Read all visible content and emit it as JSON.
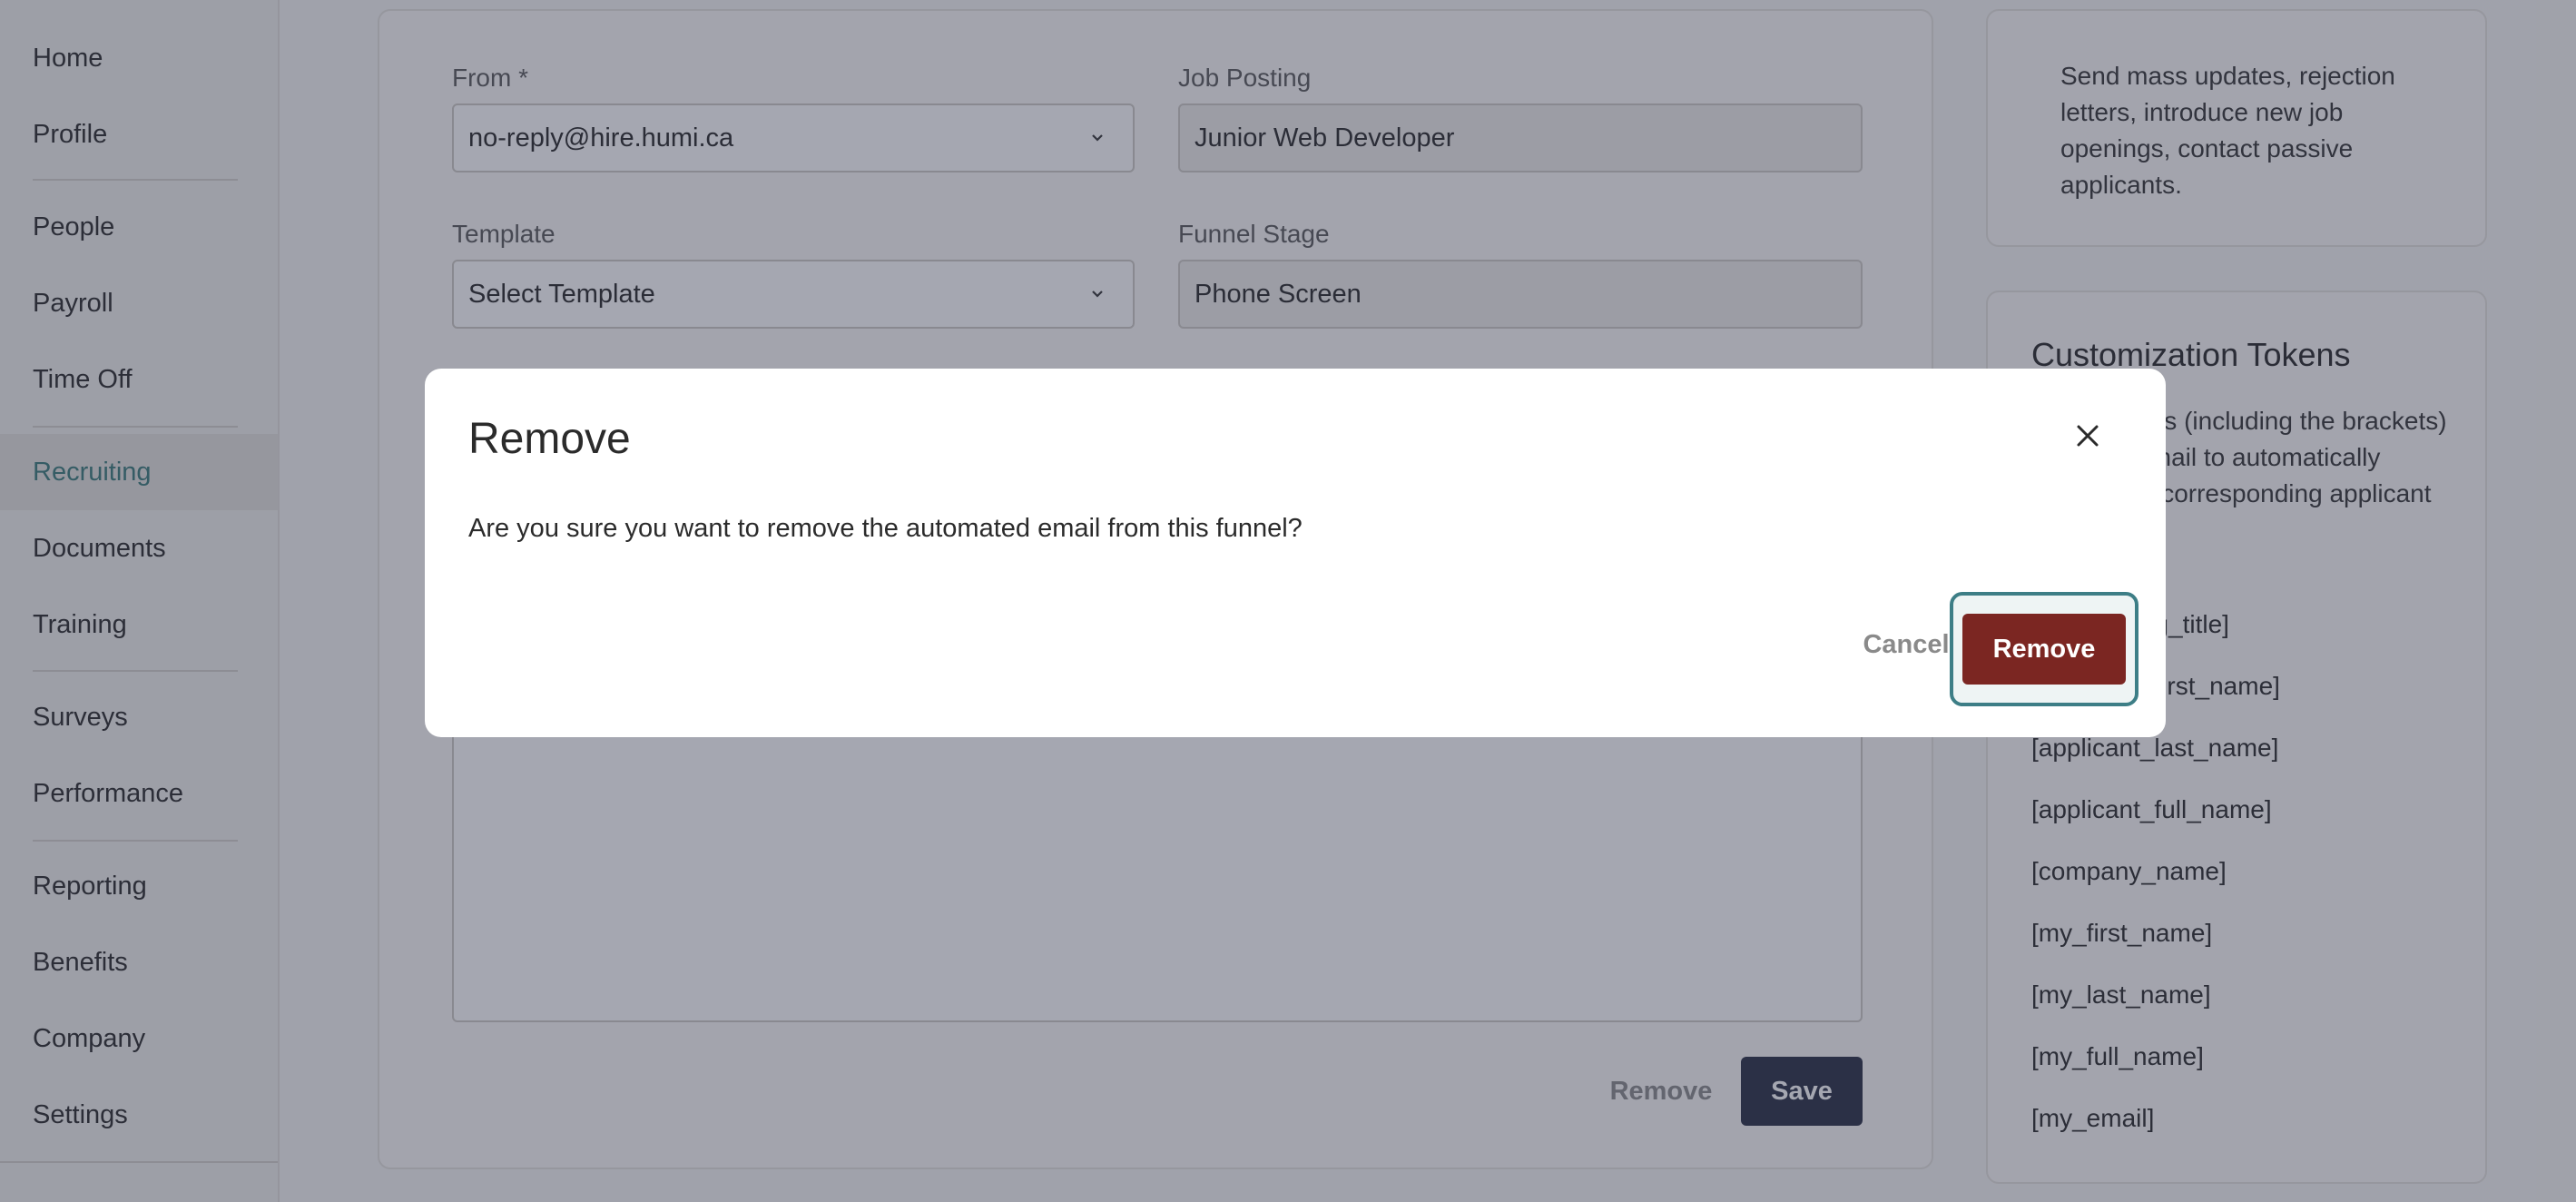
{
  "sidebar": {
    "items": [
      {
        "label": "Home"
      },
      {
        "label": "Profile"
      },
      {
        "label": "People"
      },
      {
        "label": "Payroll"
      },
      {
        "label": "Time Off"
      },
      {
        "label": "Recruiting"
      },
      {
        "label": "Documents"
      },
      {
        "label": "Training"
      },
      {
        "label": "Surveys"
      },
      {
        "label": "Performance"
      },
      {
        "label": "Reporting"
      },
      {
        "label": "Benefits"
      },
      {
        "label": "Company"
      },
      {
        "label": "Settings"
      }
    ],
    "active": "Recruiting"
  },
  "form": {
    "from": {
      "label": "From *",
      "value": "no-reply@hire.humi.ca"
    },
    "job_posting": {
      "label": "Job Posting",
      "value": "Junior Web Developer"
    },
    "template": {
      "label": "Template",
      "value": "Select Template"
    },
    "funnel_stage": {
      "label": "Funnel Stage",
      "value": "Phone Screen"
    },
    "remove_label": "Remove",
    "save_label": "Save"
  },
  "info_panel": {
    "text": "Send mass updates, rejection letters, introduce new job openings, contact passive applicants."
  },
  "tokens_panel": {
    "title": "Customization Tokens",
    "description": "Insert tokens (including the brackets) into your email to automatically include the corresponding applicant information.",
    "tokens": [
      "[job_posting_title]",
      "[applicant_first_name]",
      "[applicant_last_name]",
      "[applicant_full_name]",
      "[company_name]",
      "[my_first_name]",
      "[my_last_name]",
      "[my_full_name]",
      "[my_email]"
    ]
  },
  "modal": {
    "title": "Remove",
    "message": "Are you sure you want to remove the automated email from this funnel?",
    "cancel_label": "Cancel",
    "confirm_label": "Remove",
    "icons": {
      "close": "close-icon"
    }
  },
  "colors": {
    "accent": "#3f7f7c",
    "danger": "#7b2622",
    "primary_dark": "#2d3348",
    "overlay": "rgba(40,46,68,0.42)"
  }
}
